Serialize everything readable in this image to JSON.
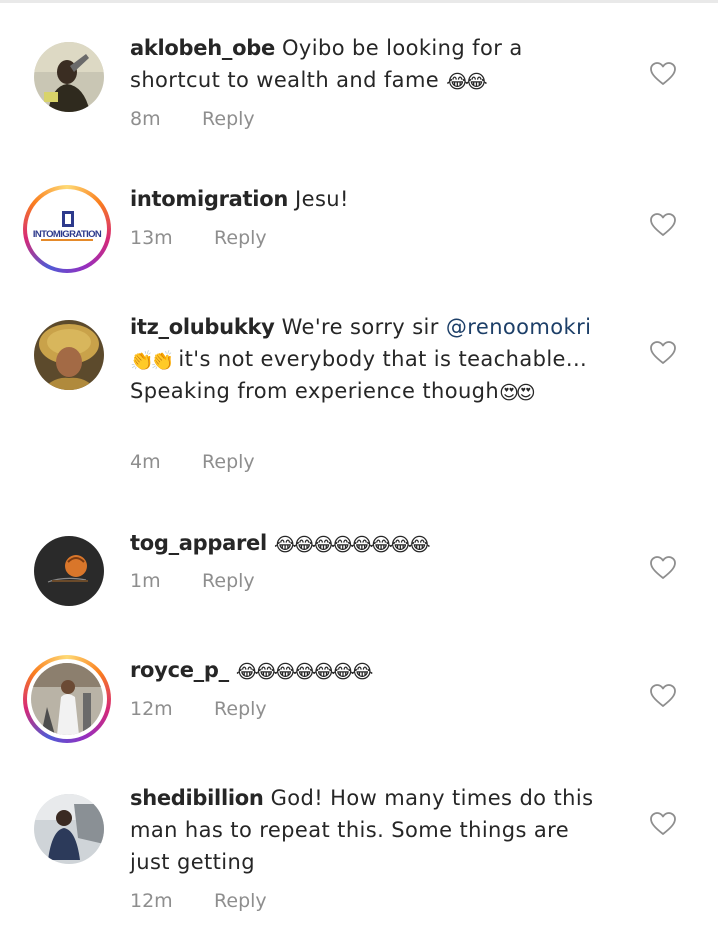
{
  "emoji_face": "😂",
  "emoji_clap": "👏",
  "emoji_heart_eyes": "😍",
  "reply_label": "Reply",
  "comments": [
    {
      "username": "aklobeh_obe",
      "text": "Oyibo be looking for a shortcut to wealth and fame",
      "emoji": "😂😂",
      "time": "8m"
    },
    {
      "username": "intomigration",
      "text": "Jesu!",
      "time": "13m",
      "avatar_text": "INTOMIGRATION"
    },
    {
      "username": "itz_olubukky",
      "text_before": "We're sorry sir",
      "mention": "@renoomokri",
      "emoji_clap": "👏👏",
      "text_after": "it's not everybody that is teachable... Speaking from experience though",
      "emoji_end": "😍😍",
      "time": "4m"
    },
    {
      "username": "tog_apparel",
      "emoji": "😂😂😂😂😂😂😂😂",
      "time": "1m"
    },
    {
      "username": "royce_p_",
      "emoji": "😂😂😂😂😂😂😂",
      "time": "12m"
    },
    {
      "username": "shedibillion",
      "text": "God! How many times do this man has to repeat this. Some things are just getting",
      "time": "12m"
    }
  ]
}
